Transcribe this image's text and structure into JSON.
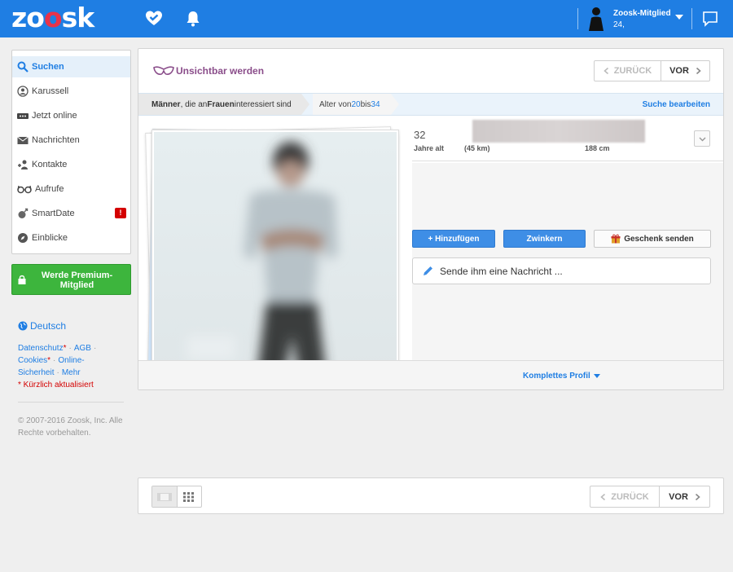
{
  "header": {
    "logo_prefix": "zo",
    "logo_heart": "o",
    "logo_suffix": "sk",
    "user_name": "Zoosk-Mitglied",
    "user_age": "24,",
    "icons": [
      "heart-check-icon",
      "bell-icon",
      "user-avatar-icon",
      "caret-down-icon",
      "chat-icon"
    ]
  },
  "sidebar": {
    "items": [
      {
        "label": "Suchen",
        "icon": "search-icon",
        "active": true
      },
      {
        "label": "Karussell",
        "icon": "carousel-icon"
      },
      {
        "label": "Jetzt online",
        "icon": "online-icon"
      },
      {
        "label": "Nachrichten",
        "icon": "envelope-icon"
      },
      {
        "label": "Kontakte",
        "icon": "contacts-icon"
      },
      {
        "label": "Aufrufe",
        "icon": "glasses-icon"
      },
      {
        "label": "SmartDate",
        "icon": "smartdate-icon",
        "badge": "!"
      },
      {
        "label": "Einblicke",
        "icon": "insights-icon"
      }
    ],
    "premium_line1": "Werde Premium-",
    "premium_line2": "Mitglied",
    "language": "Deutsch",
    "links": {
      "privacy": "Datenschutz",
      "terms": "AGB",
      "cookies": "Cookies",
      "online_safety_1": "Online-",
      "online_safety_2": "Sicherheit",
      "more": "Mehr",
      "star": "*",
      "dot": "·",
      "updated": "* Kürzlich aktualisiert"
    },
    "copyright_line1": "© 2007-2016 Zoosk, Inc. Alle",
    "copyright_line2": "Rechte vorbehalten."
  },
  "main": {
    "invisible_label": "Unsichtbar werden",
    "pager": {
      "back": "ZURÜCK",
      "forward": "VOR"
    },
    "filter": {
      "men": "Männer",
      "mid": ", die an ",
      "women": "Frauen",
      "interested": " interessiert sind",
      "age_prefix": "Alter von ",
      "age_from": "20",
      "age_bis": " bis ",
      "age_to": "34",
      "edit": "Suche bearbeiten"
    },
    "profile": {
      "age": "32",
      "age_label": "Jahre alt",
      "distance": "(45 km)",
      "height": "188 cm"
    },
    "actions": {
      "add": "+ Hinzufügen",
      "wink": "Zwinkern",
      "gift": "Geschenk senden",
      "message_placeholder": "Sende ihm eine Nachricht ..."
    },
    "full_profile": "Komplettes Profil"
  },
  "colors": {
    "brand_blue": "#1f7ee3",
    "premium_green": "#3db53d",
    "alert_red": "#d40000",
    "incognito_purple": "#8a4d8a"
  }
}
